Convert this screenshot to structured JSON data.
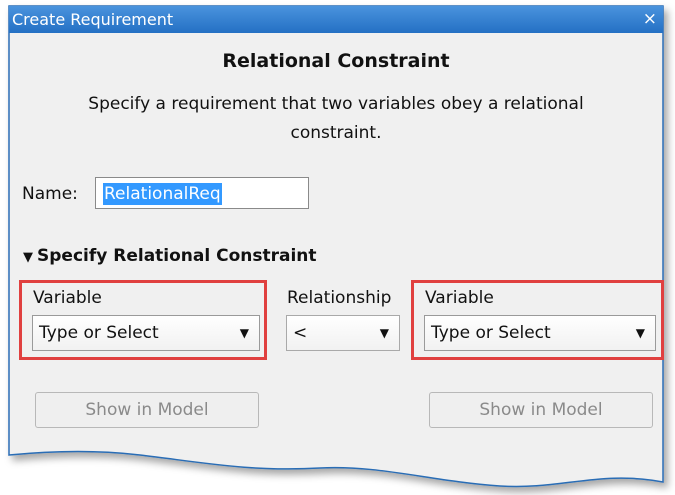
{
  "window": {
    "title": "Create Requirement",
    "close_glyph": "×"
  },
  "heading": "Relational Constraint",
  "description": "Specify a requirement that two variables obey a relational constraint.",
  "name_field": {
    "label": "Name:",
    "value": "RelationalReq"
  },
  "section": {
    "title": "Specify Relational Constraint",
    "expanded": true
  },
  "columns": {
    "left": {
      "label": "Variable",
      "value": "Type or Select",
      "button": "Show in Model",
      "button_enabled": false
    },
    "relationship": {
      "label": "Relationship",
      "value": "<"
    },
    "right": {
      "label": "Variable",
      "value": "Type or Select",
      "button": "Show in Model",
      "button_enabled": false
    }
  },
  "colors": {
    "titlebar": "#2b7fd6",
    "highlight_box": "#e0403f",
    "selection": "#3399ff"
  }
}
